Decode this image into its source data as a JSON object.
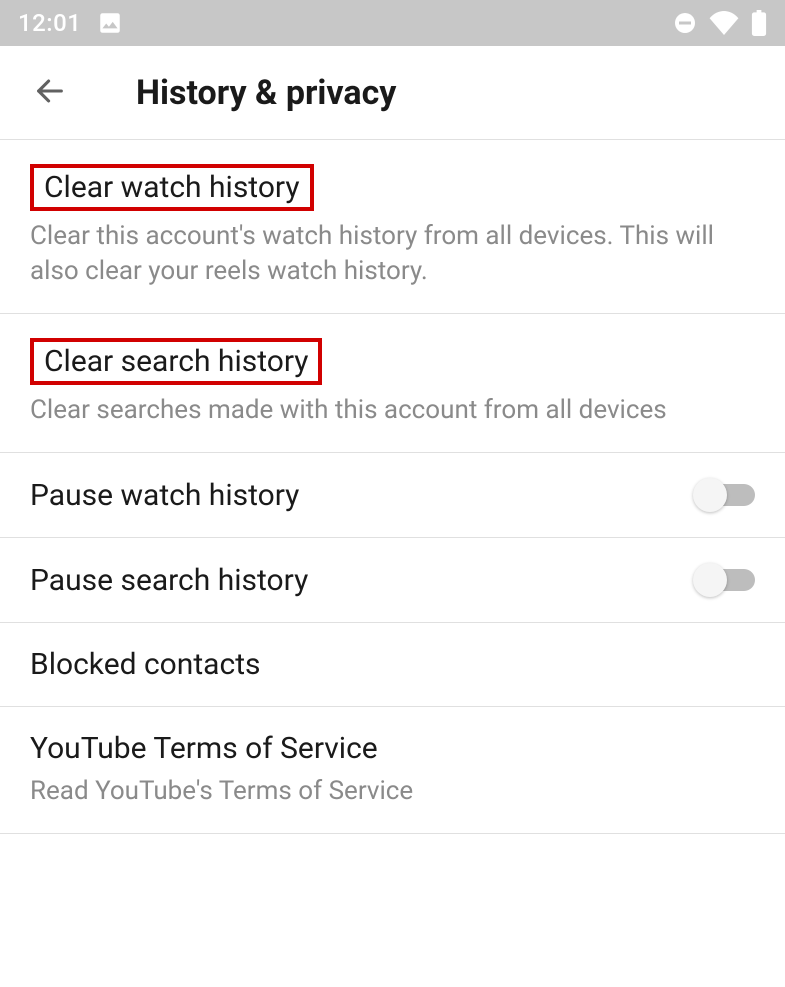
{
  "status": {
    "time": "12:01"
  },
  "header": {
    "title": "History & privacy"
  },
  "rows": {
    "clear_watch": {
      "title": "Clear watch history",
      "sub": "Clear this account's watch history from all devices. This will also clear your reels watch history."
    },
    "clear_search": {
      "title": "Clear search history",
      "sub": "Clear searches made with this account from all devices"
    },
    "pause_watch": {
      "title": "Pause watch history"
    },
    "pause_search": {
      "title": "Pause search history"
    },
    "blocked": {
      "title": "Blocked contacts"
    },
    "tos": {
      "title": "YouTube Terms of Service",
      "sub": "Read YouTube's Terms of Service"
    }
  }
}
